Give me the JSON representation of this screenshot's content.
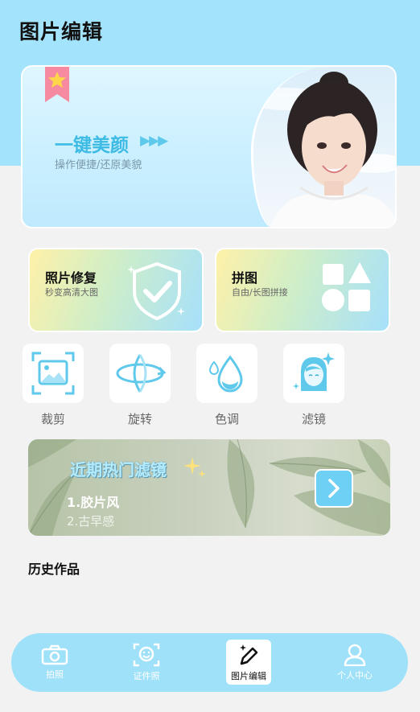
{
  "header": {
    "title": "图片编辑"
  },
  "hero": {
    "title": "一键美颜",
    "arrows": "▶▶▶",
    "subtitle": "操作便捷/还原美貌"
  },
  "features": [
    {
      "title": "照片修复",
      "subtitle": "秒变高清大图",
      "icon": "shield-check-icon"
    },
    {
      "title": "拼图",
      "subtitle": "自由/长图拼接",
      "icon": "shapes-icon"
    }
  ],
  "tools": [
    {
      "label": "裁剪",
      "icon": "crop-image-icon"
    },
    {
      "label": "旋转",
      "icon": "rotate-icon"
    },
    {
      "label": "色调",
      "icon": "color-drops-icon"
    },
    {
      "label": "滤镜",
      "icon": "filter-face-icon"
    }
  ],
  "filter_banner": {
    "title": "近期热门滤镜",
    "items": [
      "1.胶片风",
      "2.古早感"
    ]
  },
  "history": {
    "title": "历史作品"
  },
  "nav": [
    {
      "label": "拍照",
      "icon": "camera-icon"
    },
    {
      "label": "证件照",
      "icon": "id-photo-icon"
    },
    {
      "label": "图片编辑",
      "icon": "edit-pen-icon",
      "active": true
    },
    {
      "label": "个人中心",
      "icon": "person-icon"
    }
  ],
  "colors": {
    "accent": "#6fd0f5",
    "header_bg": "#a3e3fb",
    "page_bg": "#f2f2f2"
  }
}
